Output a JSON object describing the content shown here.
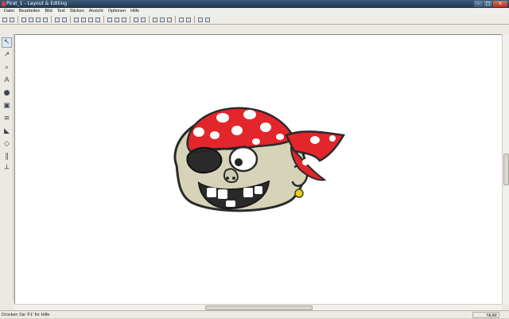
{
  "window": {
    "title": "Pirat_1 - Layout & Editing"
  },
  "menu": [
    "Datei",
    "Bearbeiten",
    "Bild",
    "Text",
    "Sticken",
    "Ansicht",
    "Optionen",
    "Hilfe"
  ],
  "toolbar_icons": [
    "new-icon",
    "open-icon",
    "save-icon",
    "save-all-icon",
    "print-icon",
    "print-preview-icon",
    "undo-icon",
    "redo-icon",
    "cut-icon",
    "copy-icon",
    "paste-icon",
    "delete-icon",
    "flip-icon",
    "rotate-icon",
    "transform-icon",
    "grid-icon",
    "align-icon",
    "text-icon",
    "arrange-icon",
    "wizard-icon",
    "preview-icon",
    "view-icon",
    "design-icon",
    "zoom-fit-icon"
  ],
  "left_tools": [
    "select-icon",
    "point-edit-icon",
    "zoom-icon",
    "text-tool-icon",
    "shape-tool-icon",
    "layer-icon",
    "stitch-icon",
    "fill-icon",
    "line-icon",
    "ruler-icon",
    "sew-icon"
  ],
  "status": {
    "hint": "Drücken Sie 'F1' für Hilfe",
    "num": "NUM"
  },
  "colors": {
    "bandana_red": "#e3262b",
    "skin": "#d6d3b8",
    "outline": "#2a2a2a",
    "earring": "#e6d21e"
  }
}
